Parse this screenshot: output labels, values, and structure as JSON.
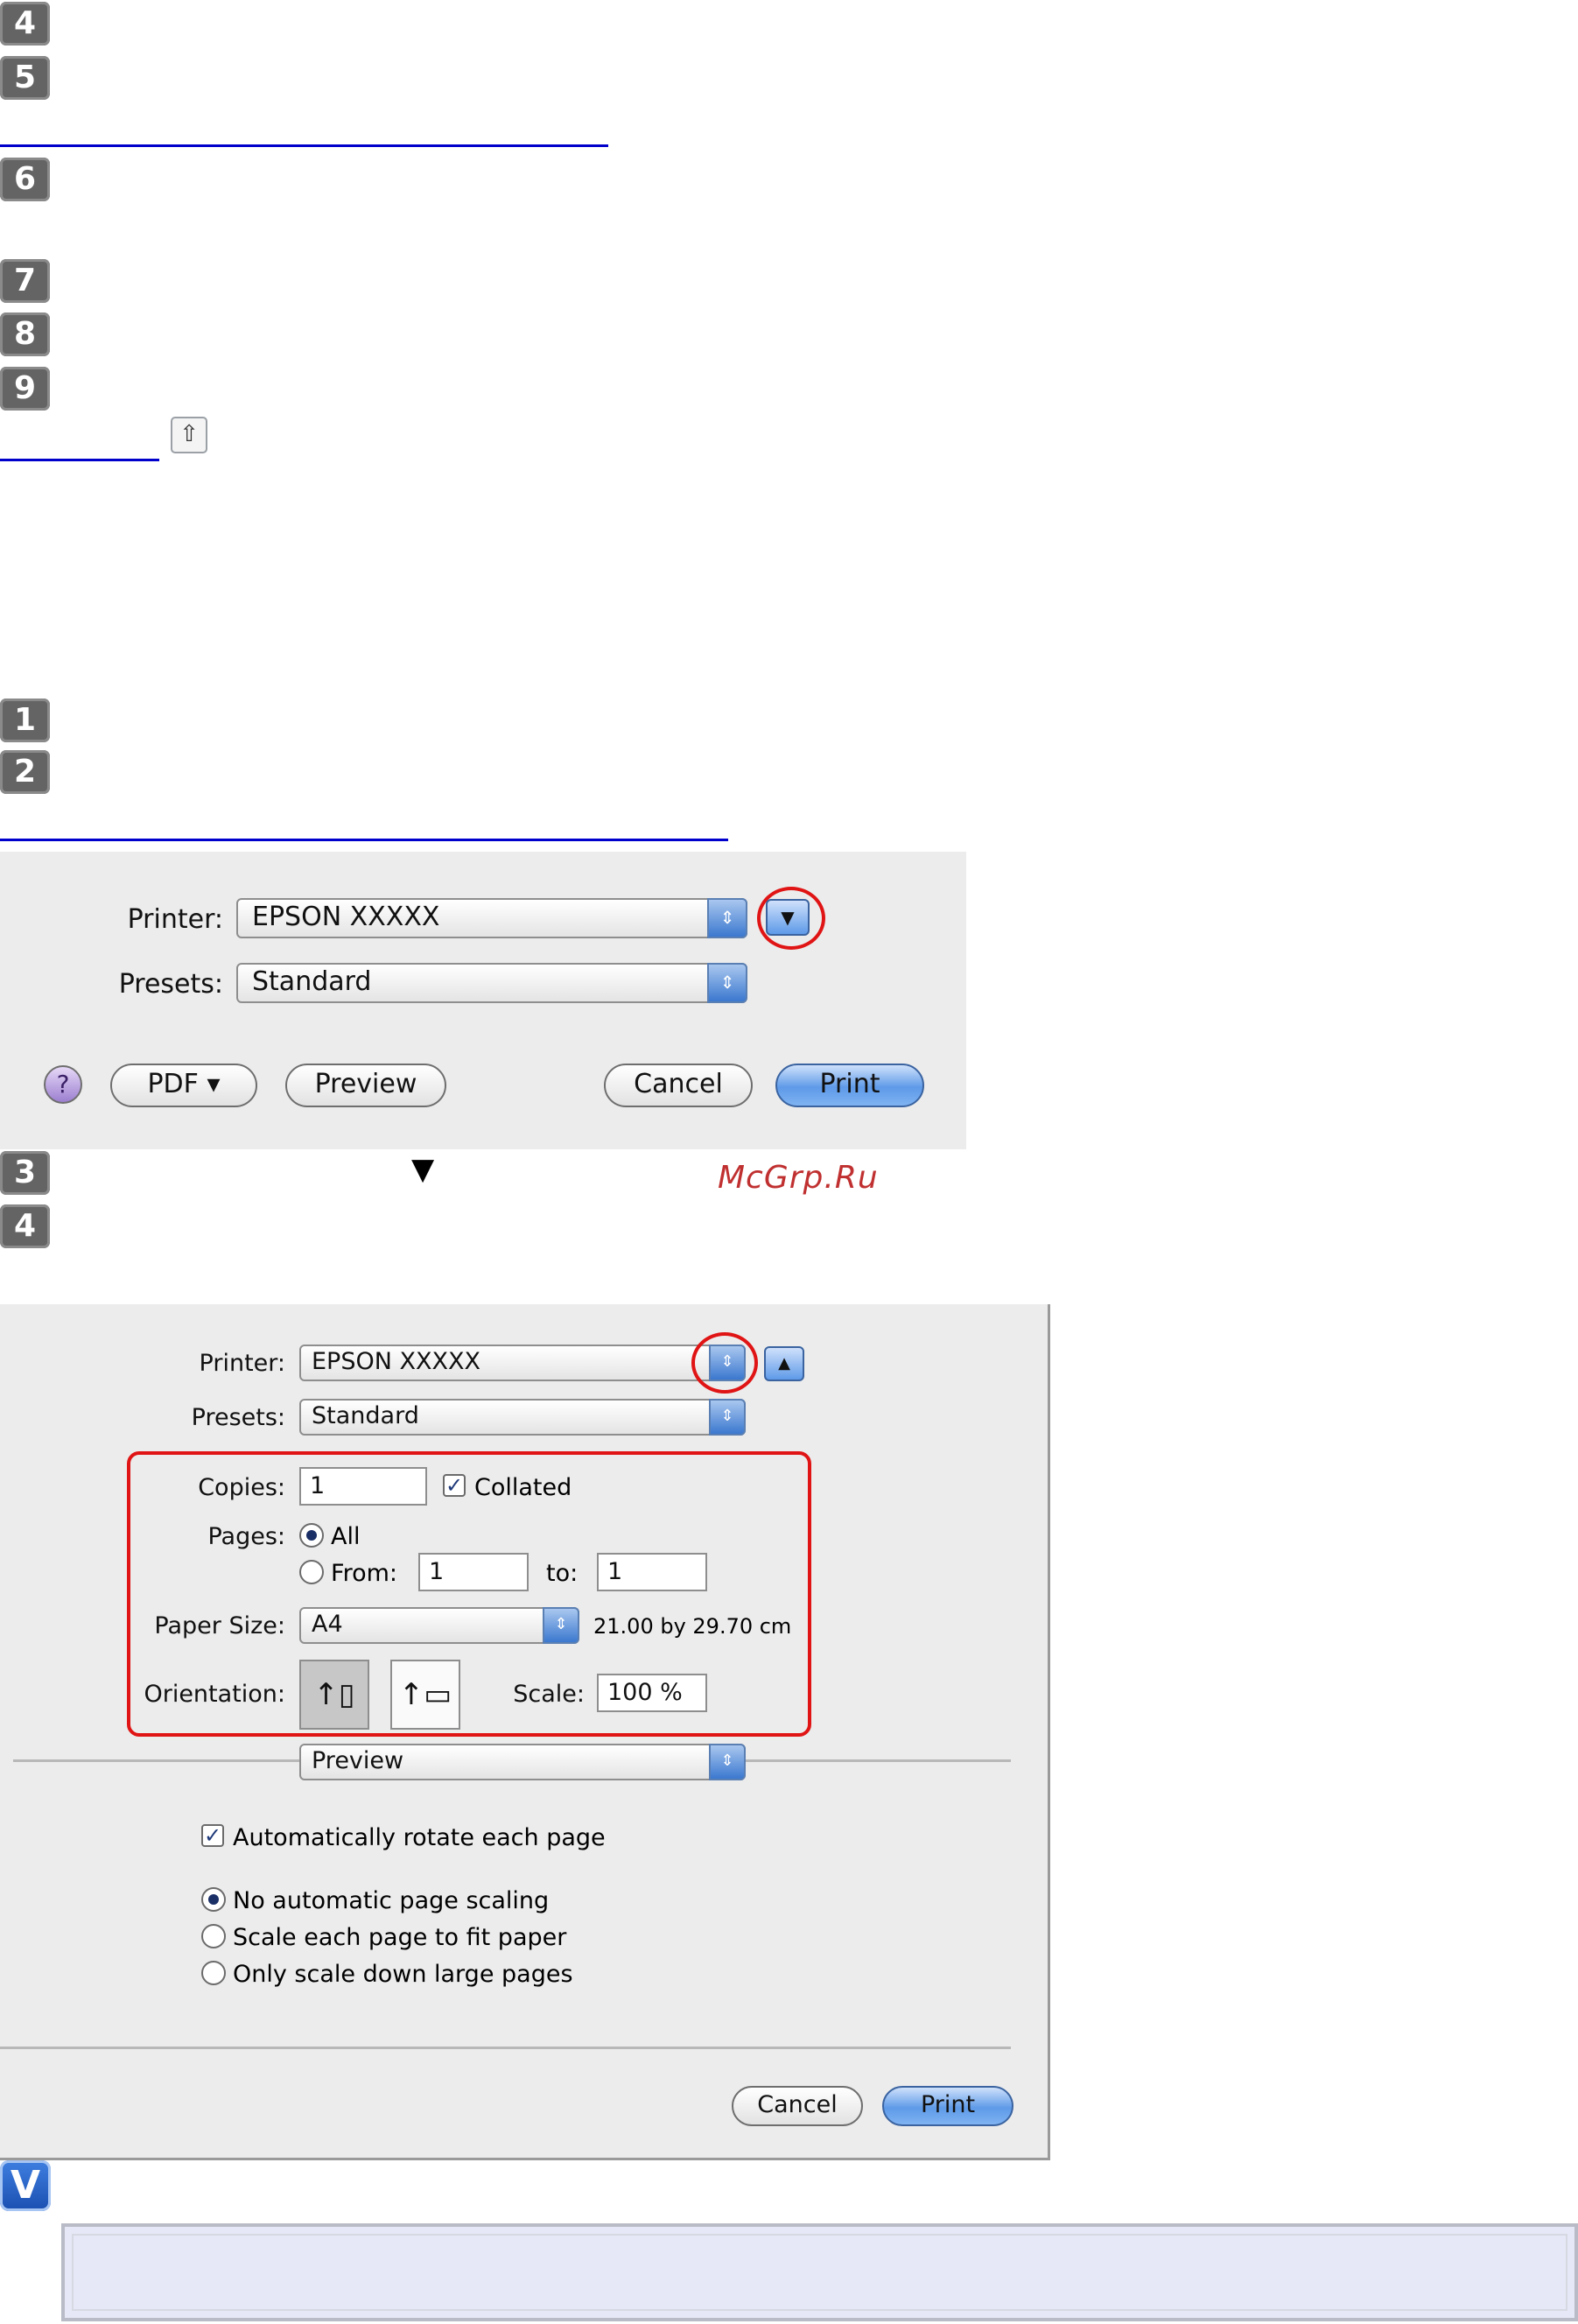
{
  "steps_top": [
    "4",
    "5",
    "6",
    "7",
    "8",
    "9"
  ],
  "steps_mid": [
    "1",
    "2"
  ],
  "steps_bottom": [
    "3",
    "4"
  ],
  "top_arrow_glyph": "⇧",
  "dialog1": {
    "printer_label": "Printer:",
    "printer_value": "EPSON XXXXX",
    "presets_label": "Presets:",
    "presets_value": "Standard",
    "help_label": "?",
    "pdf_label": "PDF ▾",
    "preview_label": "Preview",
    "cancel_label": "Cancel",
    "print_label": "Print"
  },
  "step3_triangle": "▼",
  "watermark": "McGrp.Ru",
  "dialog2": {
    "printer_label": "Printer:",
    "printer_value": "EPSON XXXXX",
    "presets_label": "Presets:",
    "presets_value": "Standard",
    "copies_label": "Copies:",
    "copies_value": "1",
    "collated_label": "Collated",
    "collated_checked": true,
    "pages_label": "Pages:",
    "all_label": "All",
    "from_label": "From:",
    "from_value": "1",
    "to_label": "to:",
    "to_value": "1",
    "paper_size_label": "Paper Size:",
    "paper_size_value": "A4",
    "paper_size_dims": "21.00 by 29.70 cm",
    "orientation_label": "Orientation:",
    "scale_label": "Scale:",
    "scale_value": "100 %",
    "section_value": "Preview",
    "auto_rotate_label": "Automatically rotate each page",
    "auto_rotate_checked": true,
    "scaling_options": [
      "No automatic page scaling",
      "Scale each page to fit paper",
      "Only scale down large pages"
    ],
    "scaling_selected": "No automatic page scaling",
    "cancel_label": "Cancel",
    "print_label": "Print"
  },
  "note_icon": "V"
}
